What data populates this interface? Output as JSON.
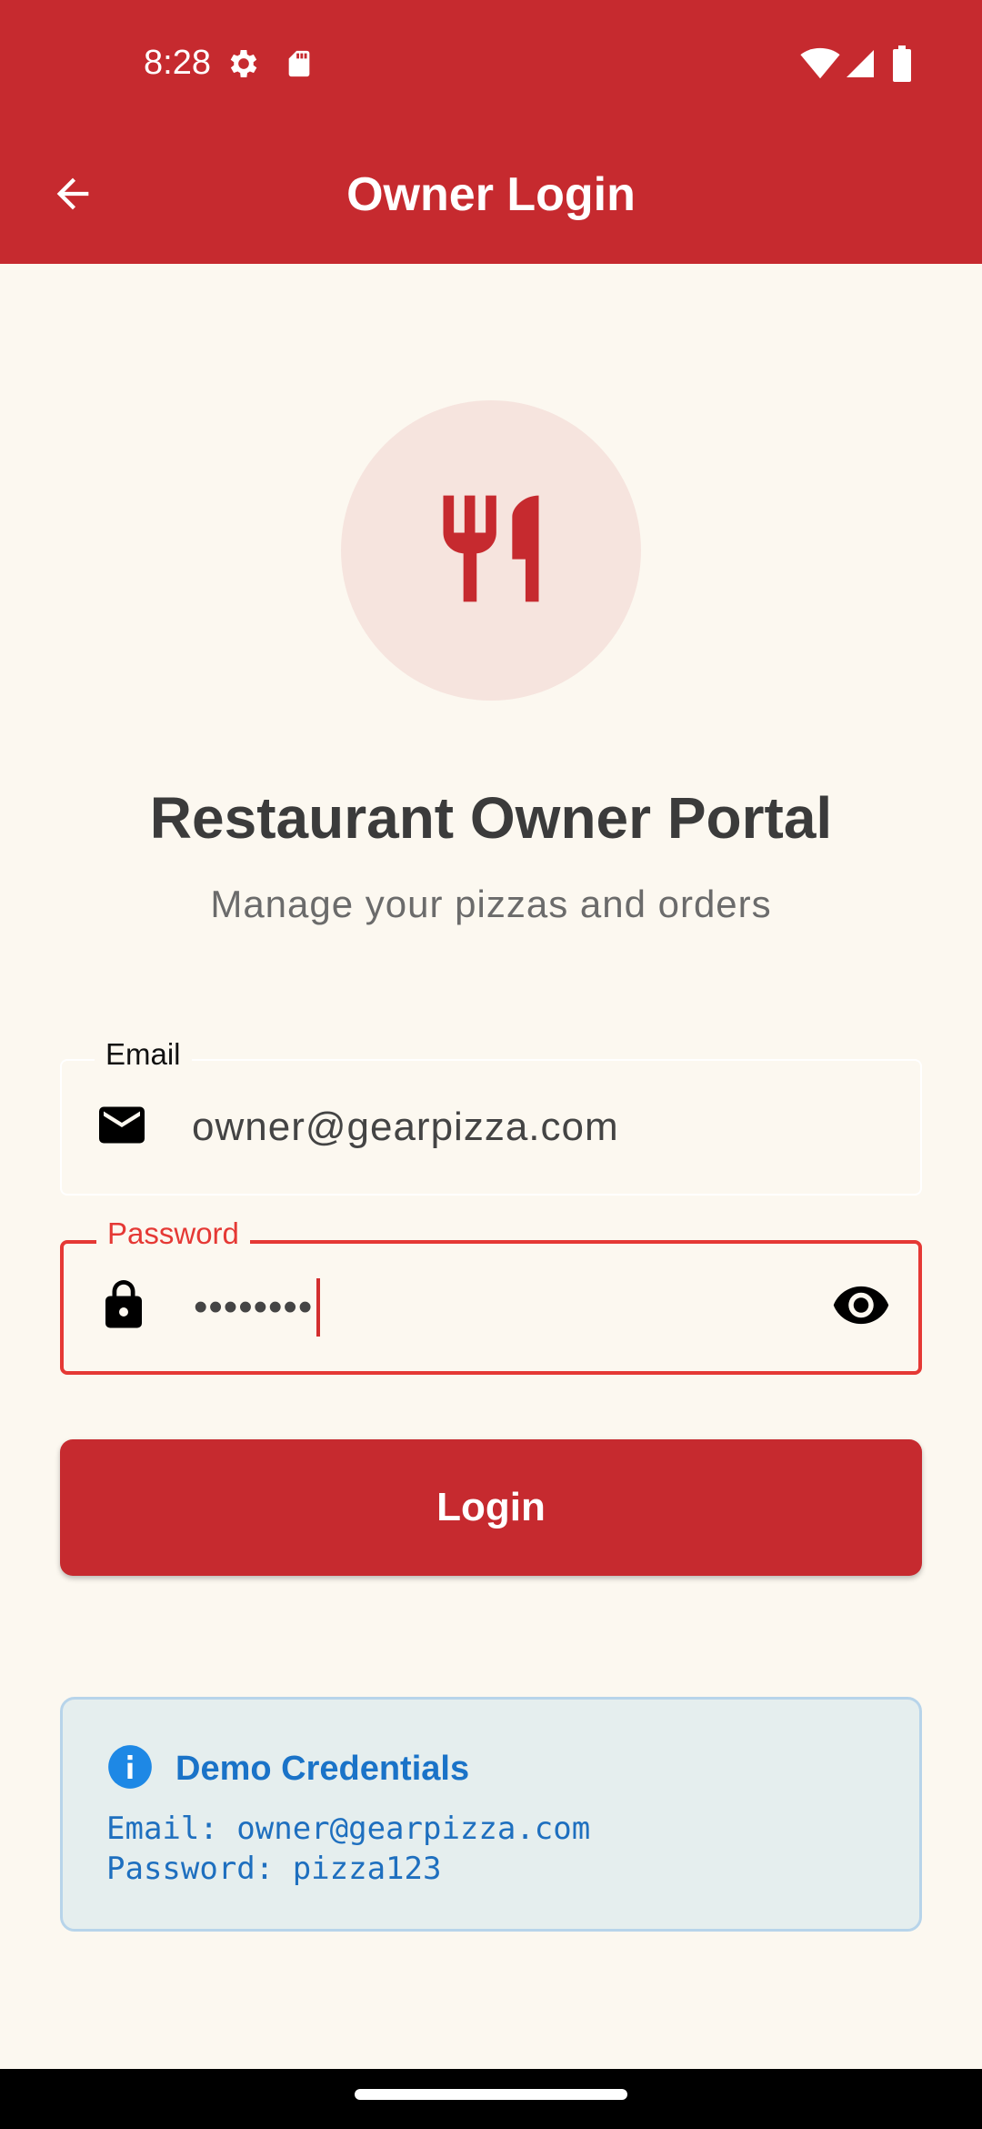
{
  "status_bar": {
    "time": "8:28",
    "icons": [
      "settings-icon",
      "sd-card-icon",
      "wifi-icon",
      "signal-icon",
      "battery-icon"
    ]
  },
  "app_bar": {
    "title": "Owner Login",
    "back_icon": "arrow-back-icon"
  },
  "hero": {
    "icon": "restaurant-icon",
    "title": "Restaurant Owner Portal",
    "subtitle": "Manage your pizzas and orders"
  },
  "form": {
    "email": {
      "label": "Email",
      "value": "owner@gearpizza.com",
      "icon": "mail-icon"
    },
    "password": {
      "label": "Password",
      "value": "••••••••",
      "icon": "lock-icon",
      "toggle_icon": "visibility-icon"
    },
    "login_label": "Login"
  },
  "demo": {
    "title": "Demo Credentials",
    "icon": "info-icon",
    "email_line": "Email: owner@gearpizza.com",
    "password_line": "Password: pizza123"
  },
  "colors": {
    "primary": "#c62a2f",
    "background": "#fcf8f0",
    "error": "#e53935",
    "info": "#1a73c8"
  }
}
